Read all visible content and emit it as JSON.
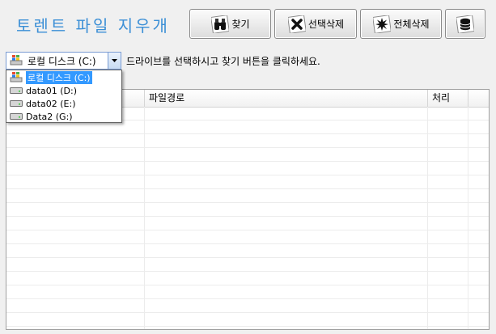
{
  "app": {
    "title": "토렌트 파일 지우개"
  },
  "toolbar": {
    "find_label": "찾기",
    "delete_selected_label": "선택삭제",
    "delete_all_label": "전체삭제"
  },
  "drive_select": {
    "selected": "로컬 디스크 (C:)",
    "hint": "드라이브를 선택하시고 찾기 버튼을 클릭하세요.",
    "options": [
      {
        "label": "로컬 디스크 (C:)",
        "icon": "windows-drive-icon"
      },
      {
        "label": "data01 (D:)",
        "icon": "hard-drive-icon"
      },
      {
        "label": "data02 (E:)",
        "icon": "hard-drive-icon"
      },
      {
        "label": "Data2 (G:)",
        "icon": "hard-drive-icon"
      }
    ]
  },
  "file_list": {
    "columns": [
      "",
      "파일경로",
      "처리"
    ],
    "rows": []
  },
  "colors": {
    "title": "#3b8fd6",
    "selection": "#3399ff",
    "combo_border": "#7a9cd3"
  }
}
